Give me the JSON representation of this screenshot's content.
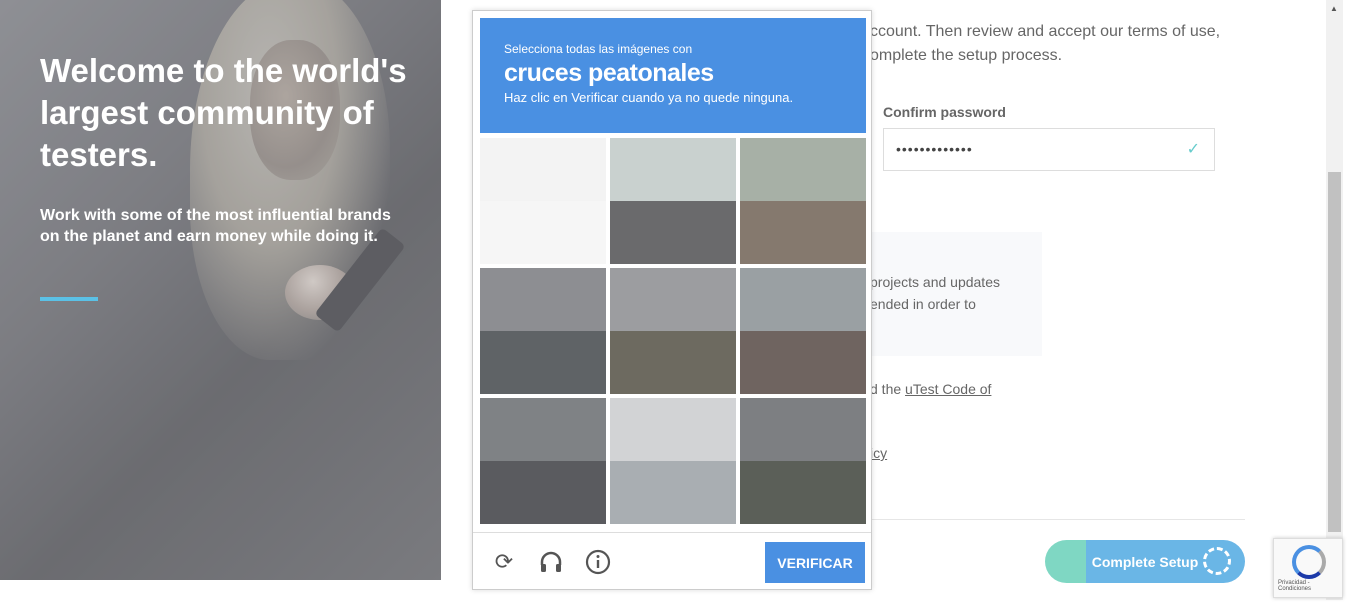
{
  "hero": {
    "title": "Welcome to the world's largest community of testers.",
    "subtitle": "Work with some of the most influential brands on the planet and earn money while doing it."
  },
  "form": {
    "intro_line1": "ccount. Then review and accept our terms of use,",
    "intro_line2": "omplete the setup process.",
    "confirm_password_label": "Confirm password",
    "confirm_password_value": "•••••••••••••",
    "info_line1": "projects and updates",
    "info_line2": "ended in order to",
    "terms_prefix": "d the ",
    "terms_link": "uTest Code of",
    "policy_fragment": "icy",
    "complete_button": "Complete Setup"
  },
  "captcha": {
    "instruction_top": "Selecciona todas las imágenes con",
    "target": "cruces peatonales",
    "instruction_bottom": "Haz clic en Verificar cuando ya no quede ninguna.",
    "verify_button": "VERIFICAR",
    "tiles": [
      {
        "sky": "#f3f3f3",
        "ground": "#f6f6f6"
      },
      {
        "sky": "#c9d1cf",
        "ground": "#6a6a6c"
      },
      {
        "sky": "#a7b0a6",
        "ground": "#85796e"
      },
      {
        "sky": "#8d8e92",
        "ground": "#5f6366"
      },
      {
        "sky": "#9c9da0",
        "ground": "#6d6a60"
      },
      {
        "sky": "#9aa0a3",
        "ground": "#6f6460"
      },
      {
        "sky": "#7f8285",
        "ground": "#5a5b5f"
      },
      {
        "sky": "#d2d3d5",
        "ground": "#a9aeb2"
      },
      {
        "sky": "#7d7f82",
        "ground": "#5b5f58"
      }
    ]
  },
  "recaptcha_badge": {
    "text": "Privacidad - Condiciones"
  },
  "colors": {
    "captcha_blue": "#4a90e2",
    "accent_teal": "#7fd7c3",
    "hero_accent": "#5bc1e6"
  },
  "icons": [
    "reload-icon",
    "headphones-icon",
    "info-icon",
    "check-icon",
    "spinner-icon",
    "recaptcha-logo-icon"
  ]
}
